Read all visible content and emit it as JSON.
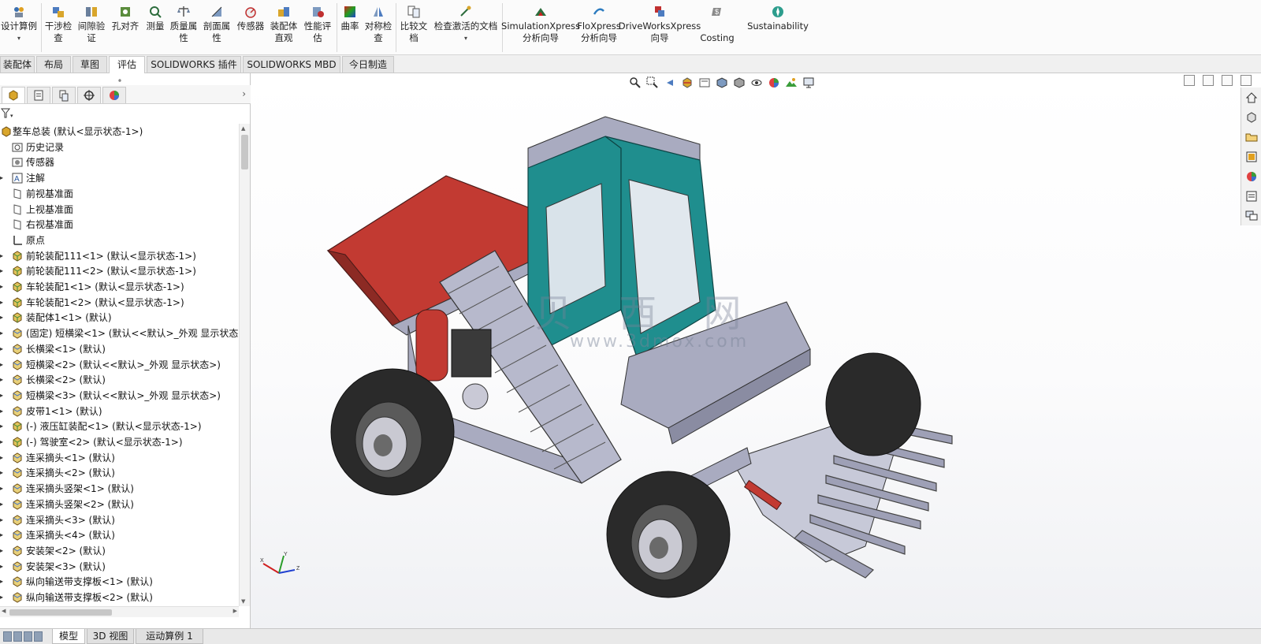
{
  "ribbon": {
    "buttons": [
      {
        "label": "设计算例",
        "icon": "design-study-icon"
      },
      {
        "label": "干涉检\n查",
        "icon": "interference-check-icon"
      },
      {
        "label": "间隙验\n证",
        "icon": "clearance-verify-icon"
      },
      {
        "label": "孔对齐",
        "icon": "hole-alignment-icon"
      },
      {
        "label": "测量",
        "icon": "measure-icon"
      },
      {
        "label": "质量属\n性",
        "icon": "mass-properties-icon"
      },
      {
        "label": "剖面属\n性",
        "icon": "section-properties-icon"
      },
      {
        "label": "传感器",
        "icon": "sensor-icon"
      },
      {
        "label": "装配体\n直观",
        "icon": "assembly-visualization-icon"
      },
      {
        "label": "性能评\n估",
        "icon": "performance-evaluation-icon"
      },
      {
        "label": "曲率",
        "icon": "curvature-icon"
      },
      {
        "label": "对称检\n查",
        "icon": "symmetry-check-icon"
      },
      {
        "label": "比较文\n档",
        "icon": "compare-documents-icon"
      },
      {
        "label": "检查激活的文档",
        "icon": "check-active-document-icon"
      },
      {
        "label": "SimulationXpress\n分析向导",
        "icon": "simulationxpress-icon"
      },
      {
        "label": "FloXpress\n分析向导",
        "icon": "floxpress-icon"
      },
      {
        "label": "DriveWorksXpress\n向导",
        "icon": "driveworksxpress-icon"
      },
      {
        "label": "Costing",
        "icon": "costing-icon"
      },
      {
        "label": "Sustainability",
        "icon": "sustainability-icon"
      }
    ],
    "dropdown_glyph": "▾"
  },
  "tabs": [
    {
      "label": "装配体",
      "active": false
    },
    {
      "label": "布局",
      "active": false
    },
    {
      "label": "草图",
      "active": false
    },
    {
      "label": "评估",
      "active": true
    },
    {
      "label": "SOLIDWORKS 插件",
      "active": false
    },
    {
      "label": "SOLIDWORKS MBD",
      "active": false
    },
    {
      "label": "今日制造",
      "active": false
    }
  ],
  "feature_tree": {
    "panel_tabs": [
      "featuremanager-icon",
      "propertymanager-icon",
      "configurationmanager-icon",
      "dimxpert-icon",
      "display-manager-icon"
    ],
    "nodes": [
      {
        "text": "整车总装  (默认<显示状态-1>)",
        "icon": "assembly-icon",
        "indent": 0,
        "expand": false
      },
      {
        "text": "历史记录",
        "icon": "history-icon",
        "indent": 1,
        "expand": false
      },
      {
        "text": "传感器",
        "icon": "sensor-folder-icon",
        "indent": 1,
        "expand": false
      },
      {
        "text": "注解",
        "icon": "annotation-icon",
        "indent": 1,
        "expand": true
      },
      {
        "text": "前视基准面",
        "icon": "plane-icon",
        "indent": 1,
        "expand": false
      },
      {
        "text": "上视基准面",
        "icon": "plane-icon",
        "indent": 1,
        "expand": false
      },
      {
        "text": "右视基准面",
        "icon": "plane-icon",
        "indent": 1,
        "expand": false
      },
      {
        "text": "原点",
        "icon": "origin-icon",
        "indent": 1,
        "expand": false
      },
      {
        "text": "前轮装配111<1> (默认<显示状态-1>)",
        "icon": "subassembly-icon",
        "indent": 1,
        "expand": true
      },
      {
        "text": "前轮装配111<2> (默认<显示状态-1>)",
        "icon": "subassembly-icon",
        "indent": 1,
        "expand": true
      },
      {
        "text": "车轮装配1<1> (默认<显示状态-1>)",
        "icon": "subassembly-icon",
        "indent": 1,
        "expand": true
      },
      {
        "text": "车轮装配1<2> (默认<显示状态-1>)",
        "icon": "subassembly-icon",
        "indent": 1,
        "expand": true
      },
      {
        "text": "装配体1<1> (默认)",
        "icon": "subassembly-icon",
        "indent": 1,
        "expand": true
      },
      {
        "text": "(固定) 短横梁<1> (默认<<默认>_外观 显示状态:",
        "icon": "part-icon",
        "indent": 1,
        "expand": true
      },
      {
        "text": "长横梁<1> (默认)",
        "icon": "part-icon",
        "indent": 1,
        "expand": true
      },
      {
        "text": "短横梁<2> (默认<<默认>_外观 显示状态>)",
        "icon": "part-icon",
        "indent": 1,
        "expand": true
      },
      {
        "text": "长横梁<2> (默认)",
        "icon": "part-icon",
        "indent": 1,
        "expand": true
      },
      {
        "text": "短横梁<3> (默认<<默认>_外观 显示状态>)",
        "icon": "part-icon",
        "indent": 1,
        "expand": true
      },
      {
        "text": "皮带1<1> (默认)",
        "icon": "part-icon",
        "indent": 1,
        "expand": true
      },
      {
        "text": "(-) 液压缸装配<1> (默认<显示状态-1>)",
        "icon": "subassembly-icon",
        "indent": 1,
        "expand": true
      },
      {
        "text": "(-) 驾驶室<2> (默认<显示状态-1>)",
        "icon": "subassembly-icon",
        "indent": 1,
        "expand": true
      },
      {
        "text": "连采摘头<1> (默认)",
        "icon": "part-icon",
        "indent": 1,
        "expand": true
      },
      {
        "text": "连采摘头<2> (默认)",
        "icon": "part-icon",
        "indent": 1,
        "expand": true
      },
      {
        "text": "连采摘头竖架<1> (默认)",
        "icon": "part-icon",
        "indent": 1,
        "expand": true
      },
      {
        "text": "连采摘头竖架<2> (默认)",
        "icon": "part-icon",
        "indent": 1,
        "expand": true
      },
      {
        "text": "连采摘头<3> (默认)",
        "icon": "part-icon",
        "indent": 1,
        "expand": true
      },
      {
        "text": "连采摘头<4> (默认)",
        "icon": "part-icon",
        "indent": 1,
        "expand": true
      },
      {
        "text": "安装架<2> (默认)",
        "icon": "part-icon",
        "indent": 1,
        "expand": true
      },
      {
        "text": "安装架<3> (默认)",
        "icon": "part-icon",
        "indent": 1,
        "expand": true
      },
      {
        "text": "纵向输送带支撑板<1> (默认)",
        "icon": "part-icon",
        "indent": 1,
        "expand": true
      },
      {
        "text": "纵向输送带支撑板<2> (默认)",
        "icon": "part-icon",
        "indent": 1,
        "expand": true
      }
    ]
  },
  "bottom_tabs": [
    {
      "label": "模型",
      "active": true
    },
    {
      "label": "3D 视图",
      "active": false
    },
    {
      "label": "运动算例 1",
      "active": false
    }
  ],
  "viewport": {
    "watermark": "贝 西 网",
    "watermark_url": "www.3dmox.com",
    "triad_labels": [
      "X",
      "Y",
      "Z"
    ]
  },
  "colors": {
    "cab_teal": "#1f8e8e",
    "hopper_red": "#c23a32",
    "frame_gray": "#a9abc0",
    "tire_dark": "#2a2a2a"
  }
}
